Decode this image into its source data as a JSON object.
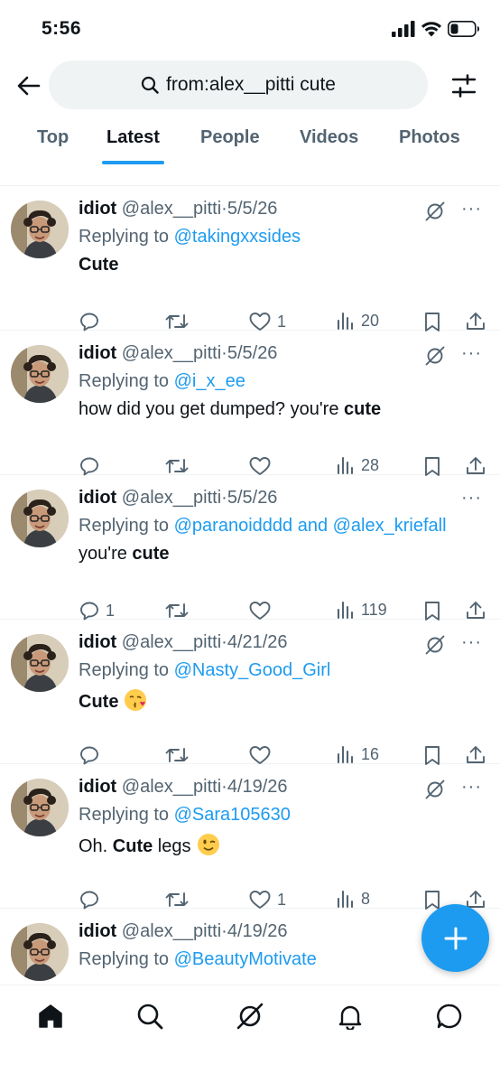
{
  "status": {
    "time": "5:56"
  },
  "search": {
    "query": "from:alex__pitti cute"
  },
  "tabs": [
    {
      "label": "Top"
    },
    {
      "label": "Latest"
    },
    {
      "label": "People"
    },
    {
      "label": "Videos"
    },
    {
      "label": "Photos"
    }
  ],
  "active_tab": "Latest",
  "tweets": [
    {
      "name": "idiot",
      "handle": "@alex__pitti",
      "sep": "·",
      "date": "5/5/26",
      "replying_prefix": "Replying to",
      "replying_to": "@takingxxsides",
      "replying_and": "",
      "replying_to2": "",
      "body_pre": "",
      "body_bold": "Cute",
      "body_post": "",
      "replies": "",
      "likes": "1",
      "views": "20",
      "grok": true
    },
    {
      "name": "idiot",
      "handle": "@alex__pitti",
      "sep": "·",
      "date": "5/5/26",
      "replying_prefix": "Replying to",
      "replying_to": "@i_x_ee",
      "replying_and": "",
      "replying_to2": "",
      "body_pre": "how did you get dumped? you're ",
      "body_bold": "cute",
      "body_post": "",
      "replies": "",
      "likes": "",
      "views": "28",
      "grok": true
    },
    {
      "name": "idiot",
      "handle": "@alex__pitti",
      "sep": "·",
      "date": "5/5/26",
      "replying_prefix": "Replying to",
      "replying_to": "@paranoidddd",
      "replying_and": " and ",
      "replying_to2": "@alex_kriefall",
      "body_pre": "you're ",
      "body_bold": "cute",
      "body_post": "",
      "replies": "1",
      "likes": "",
      "views": "119",
      "grok": false
    },
    {
      "name": "idiot",
      "handle": "@alex__pitti",
      "sep": "·",
      "date": "4/21/26",
      "replying_prefix": "Replying to",
      "replying_to": "@Nasty_Good_Girl",
      "replying_and": "",
      "replying_to2": "",
      "body_pre": "",
      "body_bold": "Cute",
      "body_post": "",
      "emoji": "face-blowing-kiss",
      "replies": "",
      "likes": "",
      "views": "16",
      "grok": true
    },
    {
      "name": "idiot",
      "handle": "@alex__pitti",
      "sep": "·",
      "date": "4/19/26",
      "replying_prefix": "Replying to",
      "replying_to": "@Sara105630",
      "replying_and": "",
      "replying_to2": "",
      "body_pre": "Oh. ",
      "body_bold": "Cute",
      "body_post": " legs",
      "emoji": "winking-face",
      "replies": "",
      "likes": "1",
      "views": "8",
      "grok": true
    },
    {
      "name": "idiot",
      "handle": "@alex__pitti",
      "sep": "·",
      "date": "4/19/26",
      "replying_prefix": "Replying to",
      "replying_to": "@BeautyMotivate",
      "replying_and": "",
      "replying_to2": "",
      "body_pre": "",
      "body_bold": "",
      "body_post": "",
      "replies": "",
      "likes": "",
      "views": "",
      "grok": false
    }
  ],
  "more_label": "···",
  "colors": {
    "accent": "#1d9bf0",
    "text": "#0f1419",
    "muted": "#536471",
    "search_bg": "#eff3f4"
  },
  "icons": {
    "status": [
      "cellular-signal-icon",
      "wifi-icon",
      "battery-icon"
    ],
    "header": [
      "back-arrow-icon",
      "search-icon",
      "filter-sliders-icon"
    ],
    "tweet_actions": [
      "reply-icon",
      "retweet-icon",
      "like-icon",
      "views-icon",
      "bookmark-icon",
      "share-icon"
    ],
    "nav": [
      "home-icon",
      "search-icon",
      "grok-icon",
      "notifications-icon",
      "messages-icon"
    ],
    "fab": "plus-icon"
  }
}
